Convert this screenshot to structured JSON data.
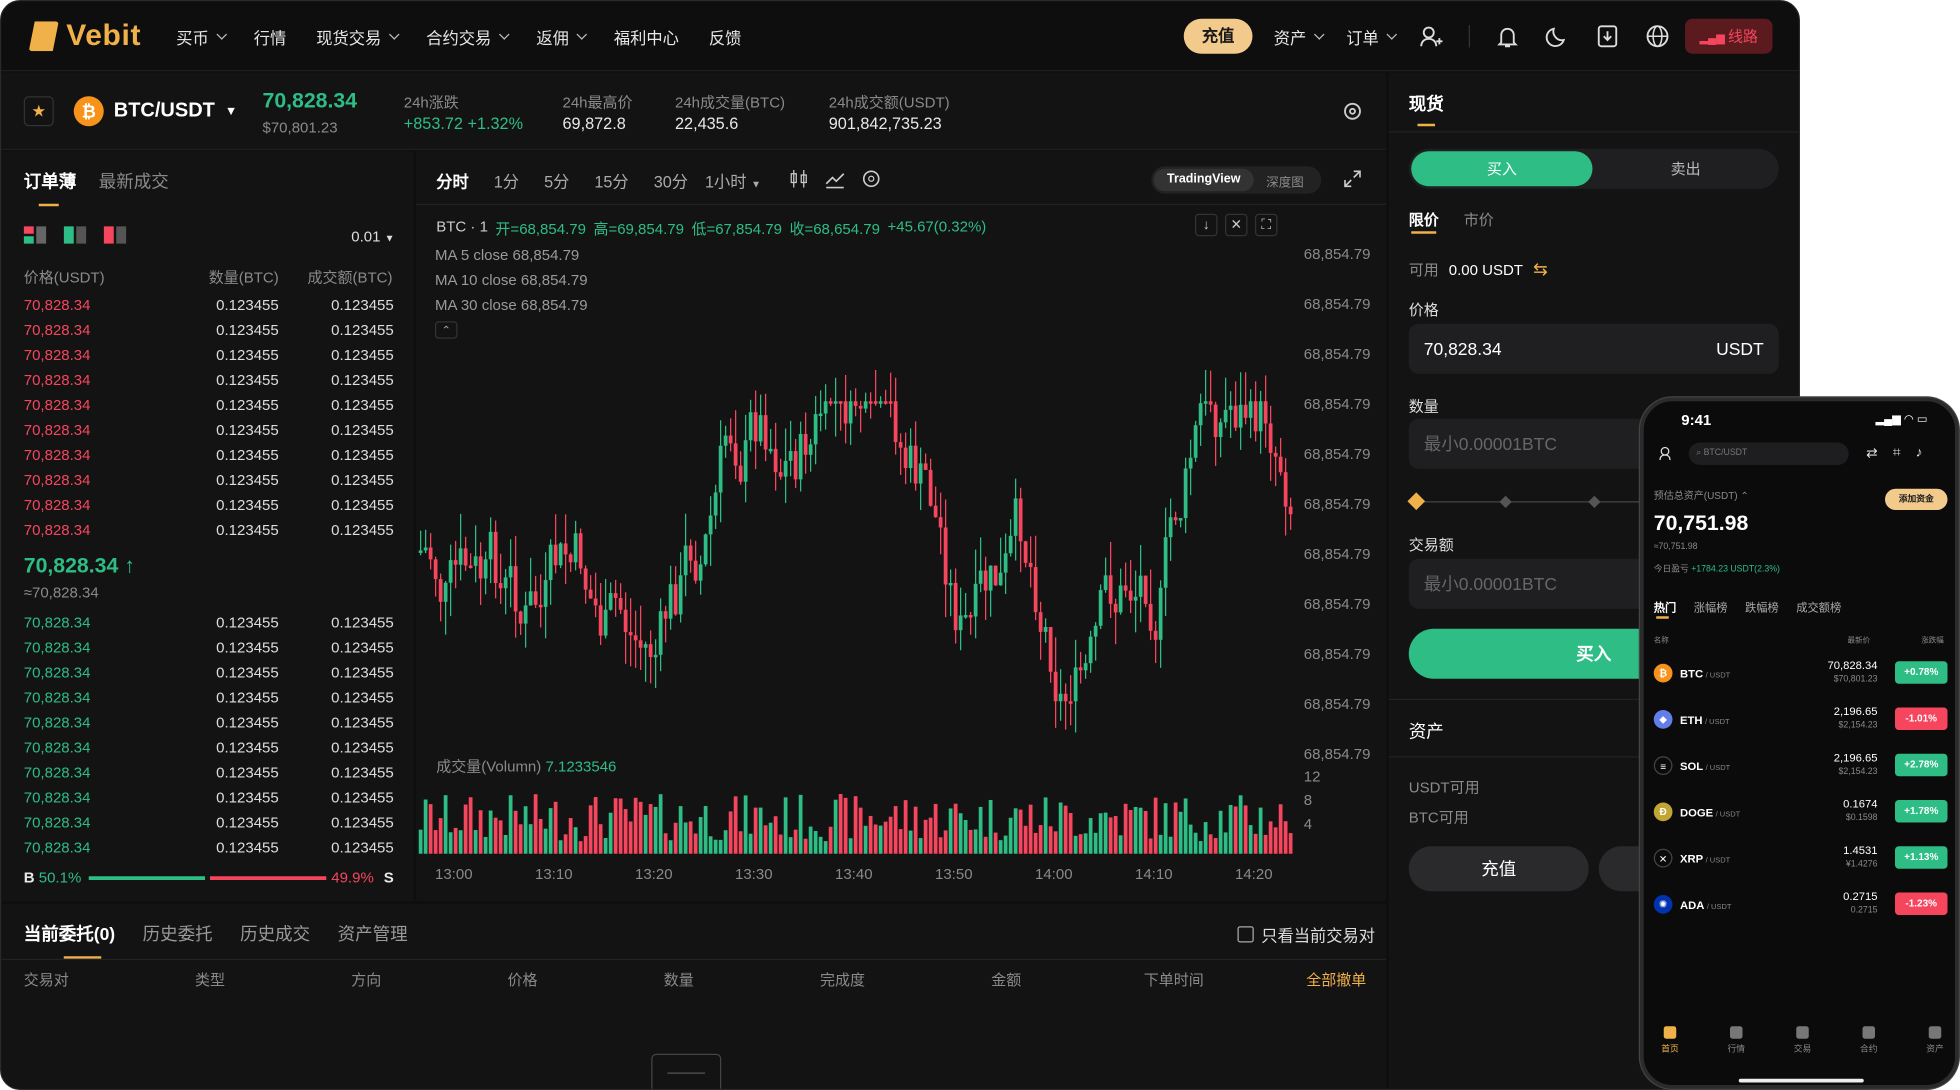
{
  "brand": {
    "name": "Vebit"
  },
  "nav": {
    "items": [
      {
        "label": "买币",
        "chev": true
      },
      {
        "label": "行情",
        "chev": false
      },
      {
        "label": "现货交易",
        "chev": true
      },
      {
        "label": "合约交易",
        "chev": true
      },
      {
        "label": "返佣",
        "chev": true
      },
      {
        "label": "福利中心",
        "chev": false
      },
      {
        "label": "反馈",
        "chev": false
      }
    ]
  },
  "header": {
    "deposit": "充值",
    "assets": "资产",
    "orders": "订单",
    "line": "线路"
  },
  "ticker": {
    "pair": "BTC/USDT",
    "price": "70,828.34",
    "price_sub": "$70,801.23",
    "change_label": "24h涨跌",
    "change": "+853.72 +1.32%",
    "high_label": "24h最高价",
    "high": "69,872.8",
    "vol_label": "24h成交量(BTC)",
    "vol": "22,435.6",
    "amt_label": "24h成交额(USDT)",
    "amt": "901,842,735.23"
  },
  "book": {
    "tab_active": "订单薄",
    "tab_other": "最新成交",
    "precision": "0.01",
    "col_price": "价格(USDT)",
    "col_qty": "数量(BTC)",
    "col_total": "成交额(BTC)",
    "asks": [
      {
        "p": "70,828.34",
        "q": "0.123455",
        "t": "0.123455"
      },
      {
        "p": "70,828.34",
        "q": "0.123455",
        "t": "0.123455"
      },
      {
        "p": "70,828.34",
        "q": "0.123455",
        "t": "0.123455"
      },
      {
        "p": "70,828.34",
        "q": "0.123455",
        "t": "0.123455"
      },
      {
        "p": "70,828.34",
        "q": "0.123455",
        "t": "0.123455"
      },
      {
        "p": "70,828.34",
        "q": "0.123455",
        "t": "0.123455"
      },
      {
        "p": "70,828.34",
        "q": "0.123455",
        "t": "0.123455"
      },
      {
        "p": "70,828.34",
        "q": "0.123455",
        "t": "0.123455"
      },
      {
        "p": "70,828.34",
        "q": "0.123455",
        "t": "0.123455"
      },
      {
        "p": "70,828.34",
        "q": "0.123455",
        "t": "0.123455"
      }
    ],
    "mid": "70,828.34 ↑",
    "mid_sub": "≈70,828.34",
    "bids": [
      {
        "p": "70,828.34",
        "q": "0.123455",
        "t": "0.123455"
      },
      {
        "p": "70,828.34",
        "q": "0.123455",
        "t": "0.123455"
      },
      {
        "p": "70,828.34",
        "q": "0.123455",
        "t": "0.123455"
      },
      {
        "p": "70,828.34",
        "q": "0.123455",
        "t": "0.123455"
      },
      {
        "p": "70,828.34",
        "q": "0.123455",
        "t": "0.123455"
      },
      {
        "p": "70,828.34",
        "q": "0.123455",
        "t": "0.123455"
      },
      {
        "p": "70,828.34",
        "q": "0.123455",
        "t": "0.123455"
      },
      {
        "p": "70,828.34",
        "q": "0.123455",
        "t": "0.123455"
      },
      {
        "p": "70,828.34",
        "q": "0.123455",
        "t": "0.123455"
      },
      {
        "p": "70,828.34",
        "q": "0.123455",
        "t": "0.123455"
      }
    ],
    "buy_label": "B",
    "buy_pct": "50.1%",
    "sell_label": "S",
    "sell_pct": "49.9%",
    "buy_ratio": 0.501
  },
  "chart": {
    "intervals": [
      "分时",
      "1分",
      "5分",
      "15分",
      "30分"
    ],
    "interval_more": "1小时",
    "view_tv": "TradingView",
    "view_depth": "深度图",
    "ohlc_sym": "BTC · 1",
    "ohlc_o": "开=68,854.79",
    "ohlc_h": "高=69,854.79",
    "ohlc_l": "低=67,854.79",
    "ohlc_c": "收=68,654.79",
    "ohlc_chg": "+45.67(0.32%)",
    "ma5": "MA 5 close 68,854.79",
    "ma10": "MA 10 close 68,854.79",
    "ma30": "MA 30 close 68,854.79",
    "price_ticks": [
      "68,854.79",
      "68,854.79",
      "68,854.79",
      "68,854.79",
      "68,854.79",
      "68,854.79",
      "68,854.79",
      "68,854.79",
      "68,854.79",
      "68,854.79",
      "68,854.79"
    ],
    "vol_label": "成交量(Volumn)",
    "vol_value": "7.1233546",
    "vol_ticks": [
      "12",
      "8",
      "4"
    ],
    "time_ticks": [
      "13:00",
      "13:10",
      "13:20",
      "13:30",
      "13:40",
      "13:50",
      "14:00",
      "14:10",
      "14:20"
    ]
  },
  "orders": {
    "tabs": [
      "当前委托(0)",
      "历史委托",
      "历史成交",
      "资产管理"
    ],
    "only_current": "只看当前交易对",
    "cols": [
      "交易对",
      "类型",
      "方向",
      "价格",
      "数量",
      "完成度",
      "金额",
      "下单时间"
    ],
    "cancel_all": "全部撤单"
  },
  "spot": {
    "title": "现货",
    "buy": "买入",
    "sell": "卖出",
    "limit": "限价",
    "market": "市价",
    "avail_label": "可用",
    "avail": "0.00 USDT",
    "price_label": "价格",
    "price": "70,828.34",
    "price_unit": "USDT",
    "qty_label": "数量",
    "qty_ph": "最小0.00001BTC",
    "amt_label": "交易额",
    "amt_ph": "最小0.00001BTC",
    "buy_btn": "买入",
    "assets_title": "资产",
    "usdt_avail": "USDT可用",
    "btc_avail": "BTC可用",
    "deposit_btn": "充值"
  },
  "phone": {
    "time": "9:41",
    "search": "BTC/USDT",
    "est_label": "预估总资产(USDT)",
    "add_funds": "添加资金",
    "total": "70,751.98",
    "total_sub": "≈70,751.98",
    "pnl_label": "今日盈亏",
    "pnl": "+1784.23 USDT(2.3%)",
    "tabs": [
      "热门",
      "涨幅榜",
      "跌幅榜",
      "成交额榜"
    ],
    "col_name": "名称",
    "col_price": "最新价",
    "col_chg": "涨跌幅",
    "coins": [
      {
        "sym": "BTC",
        "quote": "/ USDT",
        "price": "70,828.34",
        "sub": "$70,801.23",
        "chg": "+0.78%",
        "up": true,
        "color": "#f7931a",
        "glyph": "₿"
      },
      {
        "sym": "ETH",
        "quote": "/ USDT",
        "price": "2,196.65",
        "sub": "$2,154.23",
        "chg": "-1.01%",
        "up": false,
        "color": "#627eea",
        "glyph": "◆"
      },
      {
        "sym": "SOL",
        "quote": "/ USDT",
        "price": "2,196.65",
        "sub": "$2,154.23",
        "chg": "+2.78%",
        "up": true,
        "color": "#0b0b0c",
        "glyph": "≡"
      },
      {
        "sym": "DOGE",
        "quote": "/ USDT",
        "price": "0.1674",
        "sub": "$0.1598",
        "chg": "+1.78%",
        "up": true,
        "color": "#c2a633",
        "glyph": "Ð"
      },
      {
        "sym": "XRP",
        "quote": "/ USDT",
        "price": "1.4531",
        "sub": "¥1.4276",
        "chg": "+1.13%",
        "up": true,
        "color": "#0b0b0c",
        "glyph": "✕"
      },
      {
        "sym": "ADA",
        "quote": "/ USDT",
        "price": "0.2715",
        "sub": "0.2715",
        "chg": "-1.23%",
        "up": false,
        "color": "#0033ad",
        "glyph": "✺"
      }
    ],
    "bottom_tabs": [
      "首页",
      "行情",
      "交易",
      "合约",
      "资产"
    ]
  },
  "colors": {
    "up": "#2ebd85",
    "down": "#f6465d",
    "accent": "#f0b04a"
  }
}
